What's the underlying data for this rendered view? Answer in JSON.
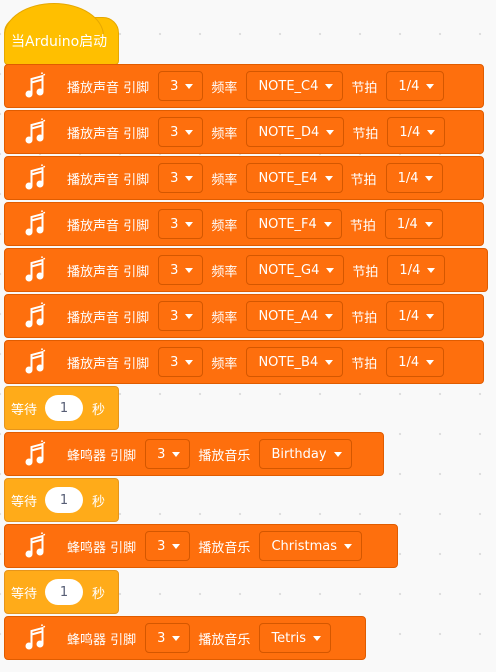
{
  "hat": {
    "label": "当Arduino启动"
  },
  "colors": {
    "hat": "#ffbf00",
    "sound": "#fe6f0d",
    "wait": "#ffab19",
    "background": "#f9f9f9"
  },
  "play_tone_blocks": [
    {
      "play_label": "播放声音 引脚",
      "pin": "3",
      "freq_label": "频率",
      "note": "NOTE_C4",
      "beat_label": "节拍",
      "beat": "1/4",
      "icon": "music-note-icon"
    },
    {
      "play_label": "播放声音 引脚",
      "pin": "3",
      "freq_label": "频率",
      "note": "NOTE_D4",
      "beat_label": "节拍",
      "beat": "1/4",
      "icon": "music-note-icon"
    },
    {
      "play_label": "播放声音 引脚",
      "pin": "3",
      "freq_label": "频率",
      "note": "NOTE_E4",
      "beat_label": "节拍",
      "beat": "1/4",
      "icon": "music-note-icon"
    },
    {
      "play_label": "播放声音 引脚",
      "pin": "3",
      "freq_label": "频率",
      "note": "NOTE_F4",
      "beat_label": "节拍",
      "beat": "1/4",
      "icon": "music-note-icon"
    },
    {
      "play_label": "播放声音 引脚",
      "pin": "3",
      "freq_label": "频率",
      "note": "NOTE_G4",
      "beat_label": "节拍",
      "beat": "1/4",
      "icon": "music-note-icon"
    },
    {
      "play_label": "播放声音 引脚",
      "pin": "3",
      "freq_label": "频率",
      "note": "NOTE_A4",
      "beat_label": "节拍",
      "beat": "1/4",
      "icon": "music-note-icon"
    },
    {
      "play_label": "播放声音 引脚",
      "pin": "3",
      "freq_label": "频率",
      "note": "NOTE_B4",
      "beat_label": "节拍",
      "beat": "1/4",
      "icon": "music-note-icon"
    }
  ],
  "wait_blocks": [
    {
      "label": "等待",
      "value": "1",
      "unit": "秒"
    },
    {
      "label": "等待",
      "value": "1",
      "unit": "秒"
    },
    {
      "label": "等待",
      "value": "1",
      "unit": "秒"
    }
  ],
  "buzzer_blocks": [
    {
      "label": "蜂鸣器 引脚",
      "pin": "3",
      "music_label": "播放音乐",
      "song": "Birthday",
      "icon": "music-note-icon"
    },
    {
      "label": "蜂鸣器 引脚",
      "pin": "3",
      "music_label": "播放音乐",
      "song": "Christmas",
      "icon": "music-note-icon"
    },
    {
      "label": "蜂鸣器 引脚",
      "pin": "3",
      "music_label": "播放音乐",
      "song": "Tetris",
      "icon": "music-note-icon"
    }
  ]
}
